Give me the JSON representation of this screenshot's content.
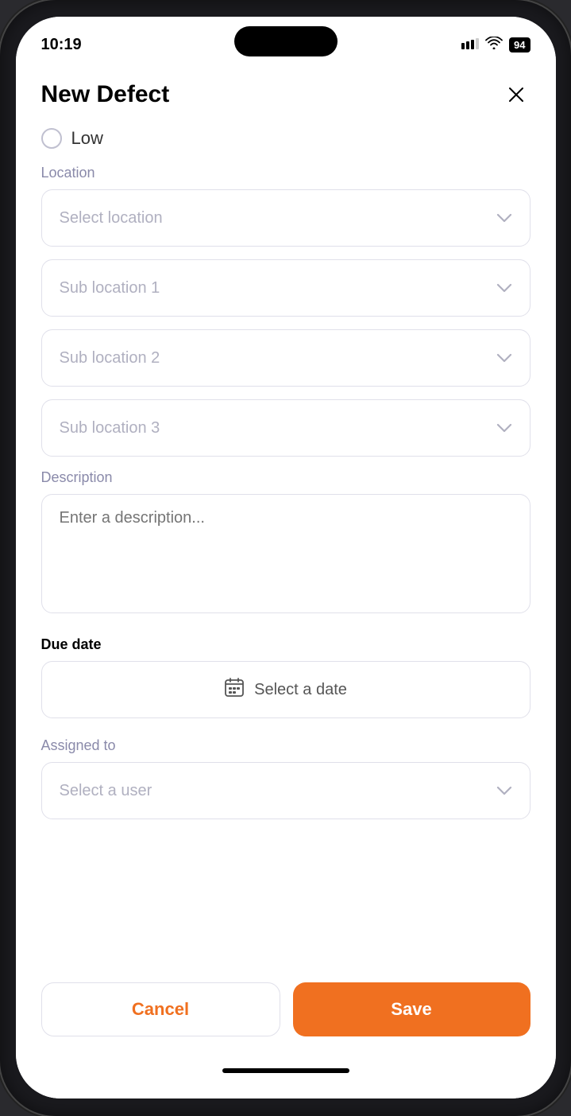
{
  "status": {
    "time": "10:19",
    "battery": "94",
    "signal": "▲▲▲",
    "wifi": "wifi"
  },
  "header": {
    "title": "New Defect",
    "close_label": "×"
  },
  "priority": {
    "label": "Low"
  },
  "location_section": {
    "label": "Location",
    "select_location_placeholder": "Select location",
    "sub_location_1_placeholder": "Sub location 1",
    "sub_location_2_placeholder": "Sub location 2",
    "sub_location_3_placeholder": "Sub location 3"
  },
  "description_section": {
    "label": "Description",
    "placeholder": "Enter a description..."
  },
  "due_date_section": {
    "label": "Due date",
    "placeholder": "Select a date"
  },
  "assigned_section": {
    "label": "Assigned to",
    "placeholder": "Select a user"
  },
  "buttons": {
    "cancel": "Cancel",
    "save": "Save"
  }
}
